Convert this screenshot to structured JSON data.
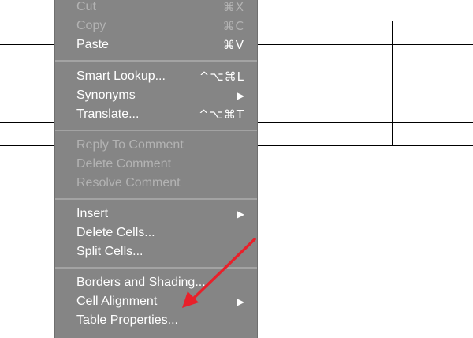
{
  "menu": {
    "groups": [
      [
        {
          "label": "Cut",
          "shortcut": "⌘X",
          "disabled": true
        },
        {
          "label": "Copy",
          "shortcut": "⌘C",
          "disabled": true
        },
        {
          "label": "Paste",
          "shortcut": "⌘V",
          "disabled": false
        }
      ],
      [
        {
          "label": "Smart Lookup...",
          "shortcut": "^⌥⌘L",
          "disabled": false
        },
        {
          "label": "Synonyms",
          "shortcut": "▶",
          "disabled": false
        },
        {
          "label": "Translate...",
          "shortcut": "^⌥⌘T",
          "disabled": false
        }
      ],
      [
        {
          "label": "Reply To Comment",
          "shortcut": "",
          "disabled": true
        },
        {
          "label": "Delete Comment",
          "shortcut": "",
          "disabled": true
        },
        {
          "label": "Resolve Comment",
          "shortcut": "",
          "disabled": true
        }
      ],
      [
        {
          "label": "Insert",
          "shortcut": "▶",
          "disabled": false
        },
        {
          "label": "Delete Cells...",
          "shortcut": "",
          "disabled": false
        },
        {
          "label": "Split Cells...",
          "shortcut": "",
          "disabled": false
        }
      ],
      [
        {
          "label": "Borders and Shading...",
          "shortcut": "",
          "disabled": false
        },
        {
          "label": "Cell Alignment",
          "shortcut": "▶",
          "disabled": false
        },
        {
          "label": "Table Properties...",
          "shortcut": "",
          "disabled": false
        }
      ]
    ]
  },
  "colors": {
    "menu_bg": "#858585",
    "enabled_text": "#ffffff",
    "disabled_text": "#b3b3b3",
    "annotation_arrow": "#e8202a"
  }
}
